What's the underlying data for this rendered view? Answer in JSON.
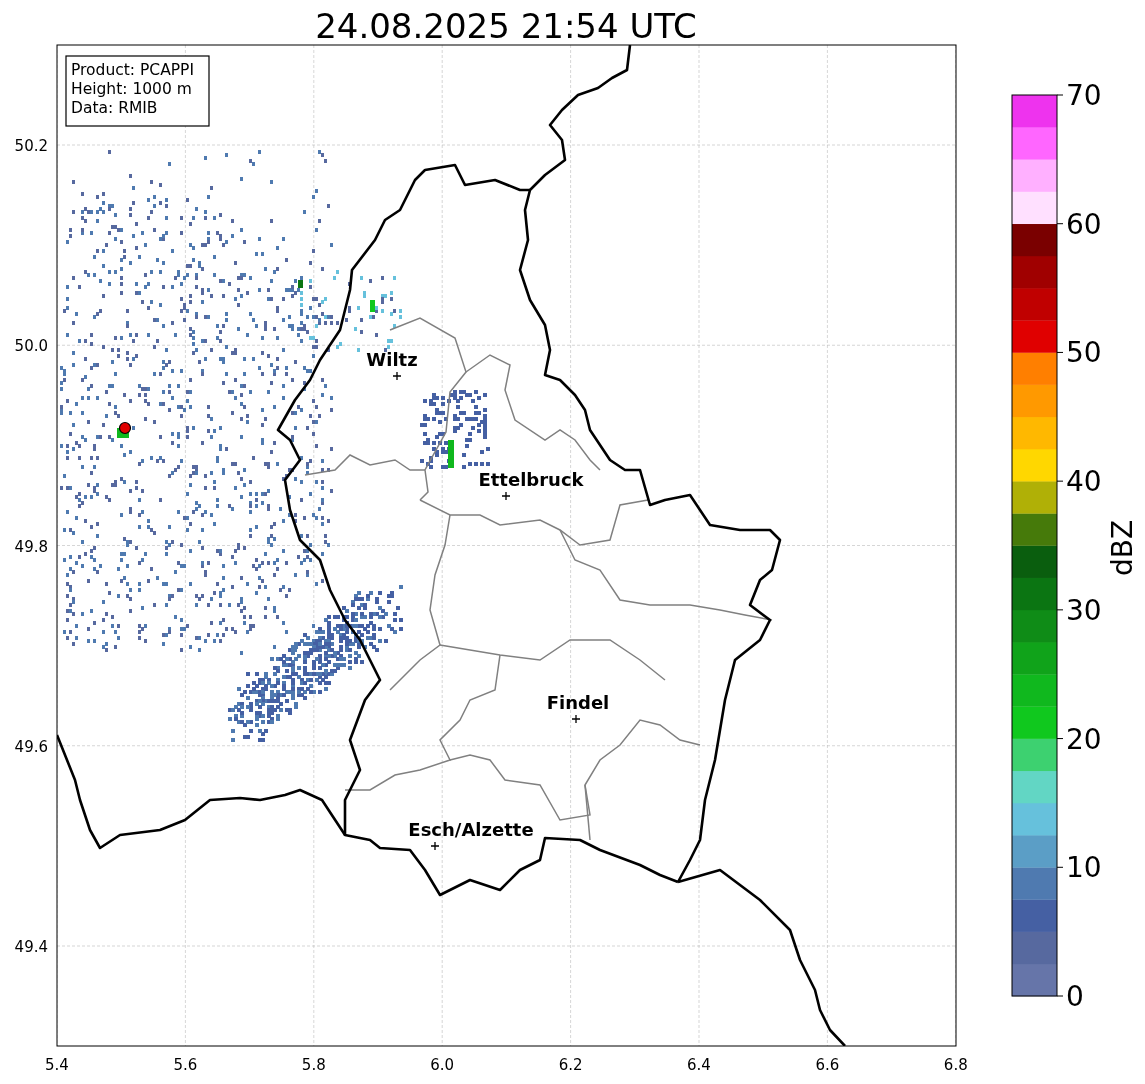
{
  "title": "24.08.2025 21:54 UTC",
  "info_box": [
    "Product: PCAPPI",
    "Height: 1000 m",
    "Data: RMIB"
  ],
  "x_ticks": [
    "5.4",
    "5.6",
    "5.8",
    "6.0",
    "6.2",
    "6.4",
    "6.6",
    "6.8"
  ],
  "y_ticks": [
    "50.2",
    "50.0",
    "49.8",
    "49.6",
    "49.4"
  ],
  "cities": [
    {
      "name": "Wiltz"
    },
    {
      "name": "Ettelbruck"
    },
    {
      "name": "Findel"
    },
    {
      "name": "Esch/Alzette"
    }
  ],
  "colorbar": {
    "label": "dBZ",
    "ticks": [
      "70",
      "60",
      "50",
      "40",
      "30",
      "20",
      "10",
      "0"
    ],
    "bins": [
      {
        "color": "#6675a9"
      },
      {
        "color": "#57699f"
      },
      {
        "color": "#4560a3"
      },
      {
        "color": "#4f7ab0"
      },
      {
        "color": "#5b9ec6"
      },
      {
        "color": "#66c1dc"
      },
      {
        "color": "#62d6c4"
      },
      {
        "color": "#3dd170"
      },
      {
        "color": "#10c81e"
      },
      {
        "color": "#10b81e"
      },
      {
        "color": "#10a31a"
      },
      {
        "color": "#0f8c17"
      },
      {
        "color": "#0b7512"
      },
      {
        "color": "#0a5e0e"
      },
      {
        "color": "#467a0a"
      },
      {
        "color": "#b0b006"
      },
      {
        "color": "#ffd700"
      },
      {
        "color": "#ffb800"
      },
      {
        "color": "#ff9900"
      },
      {
        "color": "#ff7f00"
      },
      {
        "color": "#e00000"
      },
      {
        "color": "#c00000"
      },
      {
        "color": "#a00000"
      },
      {
        "color": "#7a0000"
      },
      {
        "color": "#ffe0ff"
      },
      {
        "color": "#ffb0ff"
      },
      {
        "color": "#ff66ff"
      },
      {
        "color": "#ee33ee"
      }
    ]
  }
}
